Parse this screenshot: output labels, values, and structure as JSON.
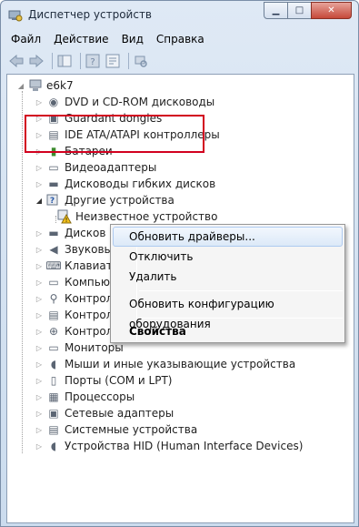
{
  "window": {
    "title": "Диспетчер устройств",
    "caption": {
      "minimize": "▁",
      "maximize": "□",
      "close": "✕"
    }
  },
  "menubar": {
    "file": "Файл",
    "action": "Действие",
    "view": "Вид",
    "help": "Справка"
  },
  "toolbar": {
    "back": "back-arrow-icon",
    "forward": "forward-arrow-icon",
    "console": "console-tree-icon",
    "help": "help-icon",
    "properties": "properties-icon",
    "scan": "scan-hardware-icon"
  },
  "tree": {
    "root": "e6k7",
    "items": [
      "DVD и CD-ROM дисководы",
      "Guardant dongles",
      "IDE ATA/ATAPI контроллеры",
      "Батареи",
      "Видеоадаптеры",
      "Дисководы гибких дисков",
      "Другие устройства",
      "Неизвестное устройство",
      "Дисков",
      "Звуковы",
      "Клавиату",
      "Компьют",
      "Контрол",
      "Контрол",
      "Контрол",
      "Мониторы",
      "Мыши и иные указывающие устройства",
      "Порты (COM и LPT)",
      "Процессоры",
      "Сетевые адаптеры",
      "Системные устройства",
      "Устройства HID (Human Interface Devices)"
    ]
  },
  "context_menu": {
    "update_drivers": "Обновить драйверы...",
    "disable": "Отключить",
    "uninstall": "Удалить",
    "scan_changes": "Обновить конфигурацию оборудования",
    "properties": "Свойства"
  },
  "colors": {
    "highlight_border": "#d2001f",
    "menu_hover": "#dce9f8"
  }
}
